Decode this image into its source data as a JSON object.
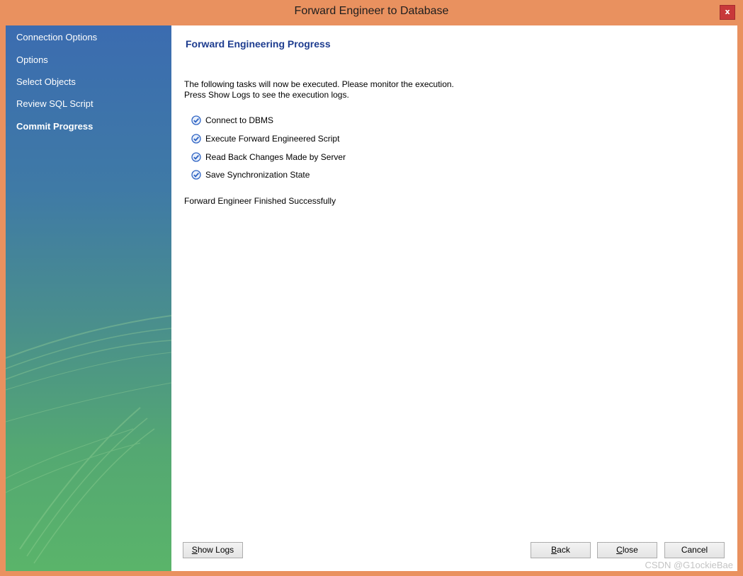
{
  "window": {
    "title": "Forward Engineer to Database",
    "close_label": "x"
  },
  "sidebar": {
    "items": [
      {
        "label": "Connection Options"
      },
      {
        "label": "Options"
      },
      {
        "label": "Select Objects"
      },
      {
        "label": "Review SQL Script"
      },
      {
        "label": "Commit Progress",
        "active": true
      }
    ]
  },
  "main": {
    "heading": "Forward Engineering Progress",
    "description_line1": "The following tasks will now be executed. Please monitor the execution.",
    "description_line2": "Press Show Logs to see the execution logs.",
    "tasks": [
      {
        "label": "Connect to DBMS",
        "done": true
      },
      {
        "label": "Execute Forward Engineered Script",
        "done": true
      },
      {
        "label": "Read Back Changes Made by Server",
        "done": true
      },
      {
        "label": "Save Synchronization State",
        "done": true
      }
    ],
    "status": "Forward Engineer Finished Successfully"
  },
  "buttons": {
    "show_logs": {
      "mnemonic": "S",
      "rest": "how Logs"
    },
    "back": {
      "mnemonic": "B",
      "rest": "ack"
    },
    "close": {
      "mnemonic": "C",
      "rest": "lose"
    },
    "cancel": {
      "label": "Cancel"
    }
  },
  "watermark": "CSDN @G1ockieBae",
  "colors": {
    "frame": "#e9915f",
    "heading": "#1d3c8f",
    "check": "#2f64c4",
    "close_button": "#c8383a"
  }
}
